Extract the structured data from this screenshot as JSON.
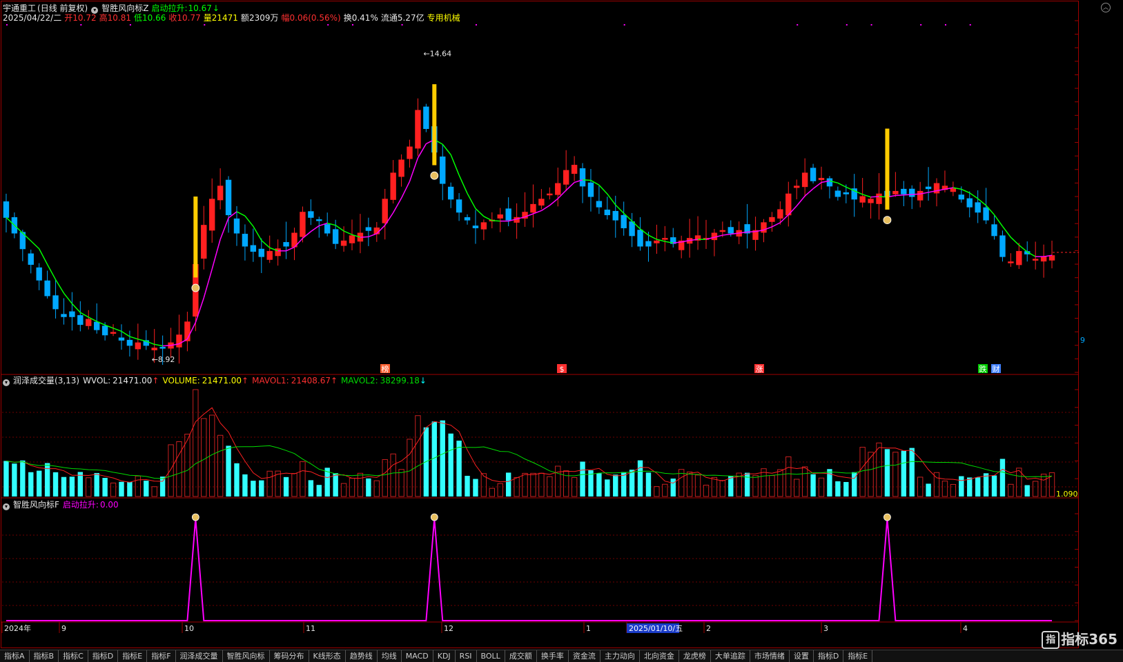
{
  "stock": {
    "name": "宇通重工",
    "mode": "(日线 前复权)"
  },
  "main_indicator": {
    "name": "智胜风向标Z",
    "signal_label": "启动拉升:",
    "signal_value": "10.67",
    "arrow": "↓"
  },
  "quote": {
    "date": "2025/04/22/二",
    "open_label": "开",
    "open": "10.72",
    "high_label": "高",
    "high": "10.81",
    "low_label": "低",
    "low": "10.66",
    "close_label": "收",
    "close": "10.77",
    "vol_label": "量",
    "vol": "21471",
    "amount_label": "额",
    "amount": "2309万",
    "change_label": "幅",
    "change": "0.06(0.56%)",
    "turnover_label": "换",
    "turnover": "0.41%",
    "float_label": "流通",
    "float": "5.27亿",
    "industry": "专用机械"
  },
  "vol_panel": {
    "name": "润泽成交量",
    "params": "(3,13)",
    "wvol_label": "WVOL:",
    "wvol": "21471.00",
    "wvol_arrow": "↑",
    "volume_label": "VOLUME:",
    "volume": "21471.00",
    "volume_arrow": "↑",
    "mavol1_label": "MAVOL1:",
    "mavol1": "21408.67",
    "mavol1_arrow": "↑",
    "mavol2_label": "MAVOL2:",
    "mavol2": "38299.18",
    "mavol2_arrow": "↓",
    "right_value": "1.090"
  },
  "sub_panel": {
    "name": "智胜风向标F",
    "signal_label": "启动拉升:",
    "signal_value": "0.00"
  },
  "chart_annotations": {
    "high": "14.64",
    "low": "8.92",
    "right_edge": "9"
  },
  "event_markers": [
    "榜",
    "$",
    "涨",
    "跌",
    "财"
  ],
  "time_axis": {
    "labels": [
      "2024年",
      "9",
      "10",
      "11",
      "12",
      "1",
      "2025/01/10/五",
      "2",
      "3",
      "4"
    ]
  },
  "bottom_tabs": [
    "指标A",
    "指标B",
    "指标C",
    "指标D",
    "指标E",
    "指标F",
    "润泽成交量",
    "智胜风向标",
    "筹码分布",
    "K线形态",
    "趋势线",
    "均线",
    "MACD",
    "KDJ",
    "RSI",
    "BOLL",
    "成交额",
    "换手率",
    "资金流",
    "主力动向",
    "北向资金",
    "龙虎榜",
    "大单追踪",
    "市场情绪",
    "设置",
    "指标D",
    "指标E"
  ],
  "logo": {
    "text": "指标365",
    "glyph": "指"
  },
  "colors": {
    "up": "#ff2020",
    "down": "#00a8ff",
    "ma_up": "#ff00ff",
    "ma_down": "#00ff00",
    "vol_up_bar": "#c82020",
    "vol_down_bar": "#33ffff",
    "signal": "#ffcc00",
    "mavol1": "#ff2020",
    "mavol2": "#00dd00"
  },
  "chart_data": {
    "type": "candlestick",
    "x_start": "2024-08-21",
    "x_end": "2025-04-22",
    "close": [
      11.5,
      11.2,
      10.9,
      10.6,
      10.3,
      10.0,
      9.75,
      9.6,
      9.6,
      9.45,
      9.55,
      9.35,
      9.25,
      9.3,
      9.15,
      9.05,
      9.1,
      9.05,
      9.0,
      9.0,
      9.1,
      9.25,
      9.5,
      10.6,
      11.35,
      11.85,
      12.1,
      11.55,
      11.2,
      10.95,
      10.85,
      10.75,
      10.85,
      10.9,
      10.95,
      11.2,
      11.6,
      11.5,
      11.45,
      11.2,
      11.0,
      11.05,
      11.15,
      11.2,
      11.25,
      11.3,
      11.85,
      12.35,
      12.6,
      12.85,
      13.55,
      13.2,
      12.75,
      12.15,
      11.85,
      11.6,
      11.45,
      11.3,
      11.4,
      11.45,
      11.55,
      11.45,
      11.5,
      11.6,
      11.75,
      11.85,
      11.95,
      12.15,
      12.4,
      12.5,
      12.1,
      11.9,
      11.7,
      11.55,
      11.45,
      11.3,
      11.15,
      10.95,
      10.95,
      11.05,
      11.1,
      11.0,
      11.05,
      11.1,
      11.15,
      11.1,
      11.2,
      11.25,
      11.2,
      11.25,
      11.2,
      11.25,
      11.4,
      11.5,
      11.65,
      11.95,
      12.1,
      12.35,
      12.2,
      12.25,
      12.1,
      11.9,
      11.95,
      11.85,
      11.9,
      11.85,
      11.95,
      11.9,
      12.0,
      11.95,
      11.9,
      12.0,
      12.05,
      12.15,
      12.1,
      12.05,
      11.85,
      11.7,
      11.6,
      11.45,
      11.15,
      10.75,
      10.65,
      10.85,
      10.8,
      10.7,
      10.75,
      10.77
    ],
    "volume_panel": {
      "series": [
        {
          "name": "WVOL"
        },
        {
          "name": "MAVOL1"
        },
        {
          "name": "MAVOL2"
        }
      ]
    },
    "signals": {
      "name": "启动拉升",
      "bars_at_x": [
        23,
        52,
        107
      ]
    }
  }
}
